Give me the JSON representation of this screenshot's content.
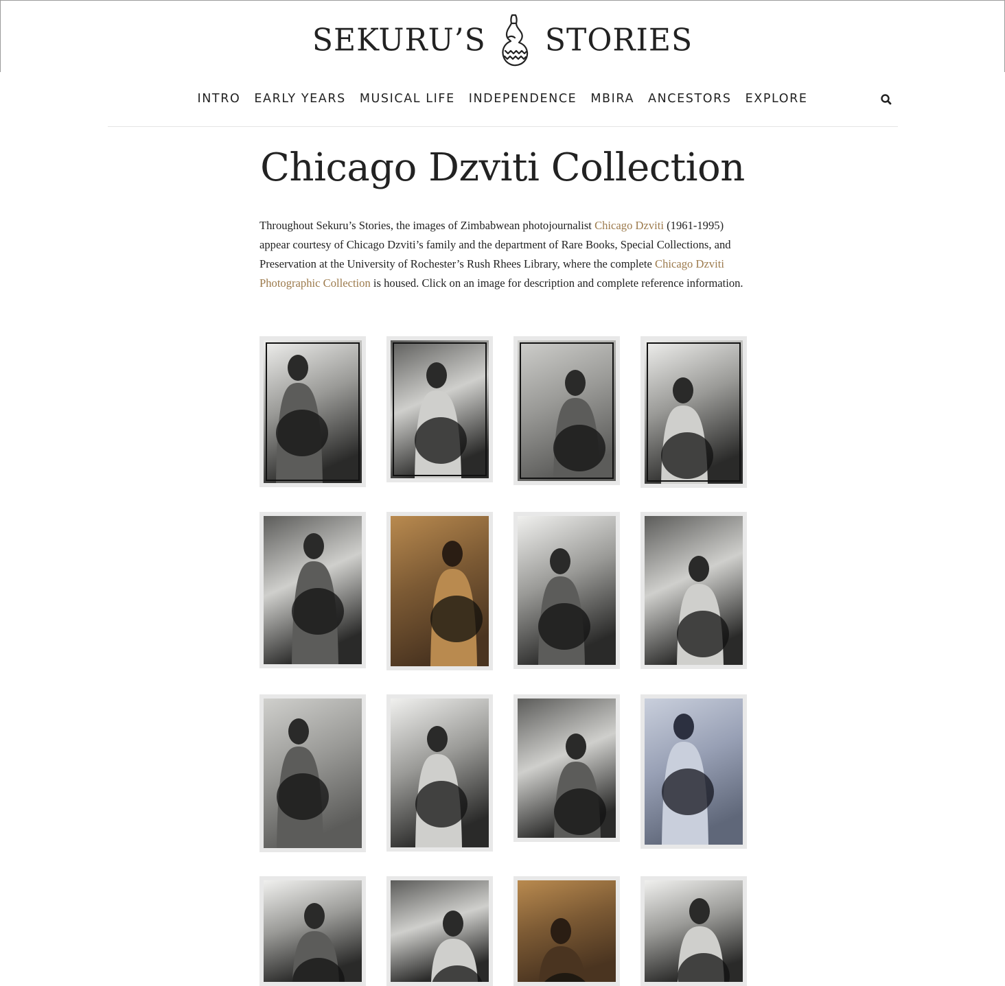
{
  "site": {
    "logo_left": "SEKURU’S",
    "logo_right": "STORIES"
  },
  "nav": {
    "items": [
      "INTRO",
      "EARLY YEARS",
      "MUSICAL LIFE",
      "INDEPENDENCE",
      "MBIRA",
      "ANCESTORS",
      "EXPLORE"
    ],
    "search_icon": "search-icon"
  },
  "page": {
    "title": "Chicago Dzviti Collection",
    "intro": {
      "part1": "Throughout Sekuru’s Stories, the images of Zimbabwean photojournalist ",
      "link1": "Chicago Dzviti",
      "part2": " (1961-1995) appear courtesy of Chicago Dzviti’s family and the department of Rare Books, Special Collections, and Preservation at the University of Rochester’s Rush Rhees Library, where the complete ",
      "link2": "Chicago Dzviti Photographic Collection",
      "part3": " is housed. Click on an image for description and complete reference information."
    }
  },
  "colors": {
    "link": "#9c7a4c",
    "text": "#222222",
    "thumb_mat": "#e8e8e8"
  },
  "gallery": {
    "items": [
      {
        "tone": "bw"
      },
      {
        "tone": "bw"
      },
      {
        "tone": "bw"
      },
      {
        "tone": "bw"
      },
      {
        "tone": "bw"
      },
      {
        "tone": "color"
      },
      {
        "tone": "bw"
      },
      {
        "tone": "bw"
      },
      {
        "tone": "bw"
      },
      {
        "tone": "bw"
      },
      {
        "tone": "bw"
      },
      {
        "tone": "bw-blue"
      },
      {
        "tone": "bw"
      },
      {
        "tone": "bw"
      },
      {
        "tone": "color"
      },
      {
        "tone": "bw"
      }
    ]
  }
}
